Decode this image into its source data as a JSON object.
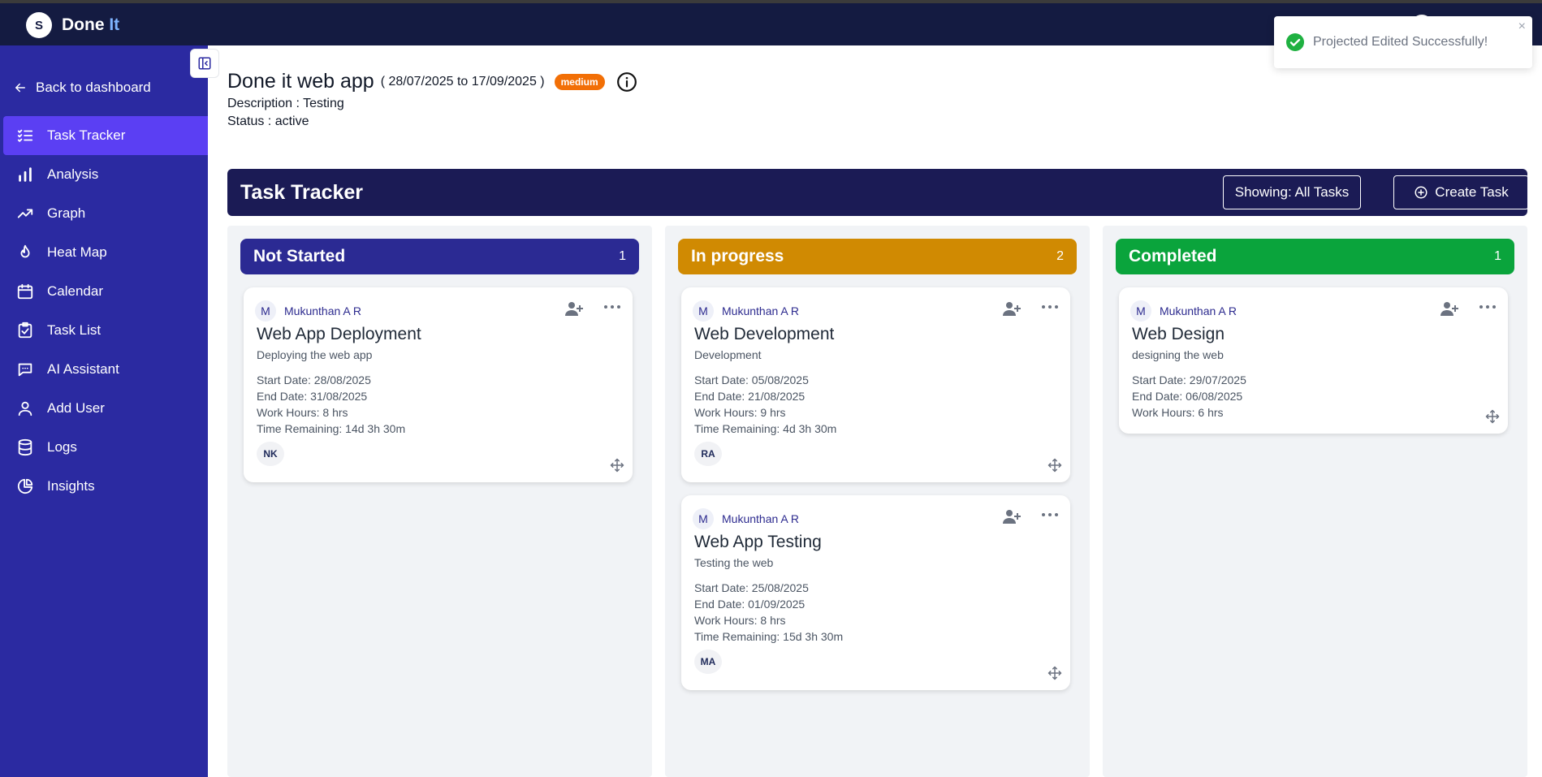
{
  "app": {
    "logo_initials": "S",
    "logo_text_first": "D",
    "logo_text_mid": "one ",
    "logo_text_accent": "It",
    "brand_color": "#141b41",
    "sidebar_color": "#2b2aa1",
    "active_color": "#5b3ff3"
  },
  "sidebar": {
    "back_label": "Back to dashboard",
    "items": [
      {
        "label": "Task Tracker",
        "icon": "checklist-icon",
        "active": true
      },
      {
        "label": "Analysis",
        "icon": "bar-chart-icon"
      },
      {
        "label": "Graph",
        "icon": "line-graph-icon"
      },
      {
        "label": "Heat Map",
        "icon": "flame-icon"
      },
      {
        "label": "Calendar",
        "icon": "calendar-icon"
      },
      {
        "label": "Task List",
        "icon": "clipboard-check-icon"
      },
      {
        "label": "AI Assistant",
        "icon": "chat-icon"
      },
      {
        "label": "Add User",
        "icon": "user-icon"
      },
      {
        "label": "Logs",
        "icon": "database-icon"
      },
      {
        "label": "Insights",
        "icon": "pie-chart-icon"
      }
    ]
  },
  "project": {
    "name": "Done it web app",
    "dates": "( 28/07/2025 to 17/09/2025 )",
    "priority": "medium",
    "description": "Description : Testing",
    "status": "Status : active"
  },
  "tracker": {
    "title": "Task Tracker",
    "filter_label": "Showing: All Tasks",
    "create_label": "Create Task"
  },
  "columns": [
    {
      "title": "Not Started",
      "count": "1",
      "color": "#2b2a93",
      "cards": [
        {
          "owner_initial": "M",
          "owner": "Mukunthan A R",
          "title": "Web App Deployment",
          "desc": "Deploying the web app",
          "start": "Start Date: 28/08/2025",
          "end": "End Date: 31/08/2025",
          "hours": "Work Hours: 8 hrs",
          "remaining": "Time Remaining: 14d 3h 30m",
          "assignee": "NK"
        }
      ]
    },
    {
      "title": "In progress",
      "count": "2",
      "color": "#d08a02",
      "cards": [
        {
          "owner_initial": "M",
          "owner": "Mukunthan A R",
          "title": "Web Development",
          "desc": "Development",
          "start": "Start Date: 05/08/2025",
          "end": "End Date: 21/08/2025",
          "hours": "Work Hours: 9 hrs",
          "remaining": "Time Remaining: 4d 3h 30m",
          "assignee": "RA"
        },
        {
          "owner_initial": "M",
          "owner": "Mukunthan A R",
          "title": "Web App Testing",
          "desc": "Testing the web",
          "start": "Start Date: 25/08/2025",
          "end": "End Date: 01/09/2025",
          "hours": "Work Hours: 8 hrs",
          "remaining": "Time Remaining: 15d 3h 30m",
          "assignee": "MA"
        }
      ]
    },
    {
      "title": "Completed",
      "count": "1",
      "color": "#0aa43c",
      "cards": [
        {
          "owner_initial": "M",
          "owner": "Mukunthan A R",
          "title": "Web Design",
          "desc": "designing the web",
          "start": "Start Date: 29/07/2025",
          "end": "End Date: 06/08/2025",
          "hours": "Work Hours: 6 hrs"
        }
      ]
    }
  ],
  "toast": {
    "message": "Projected Edited Successfully!",
    "close": "×",
    "success_color": "#1fb141"
  }
}
